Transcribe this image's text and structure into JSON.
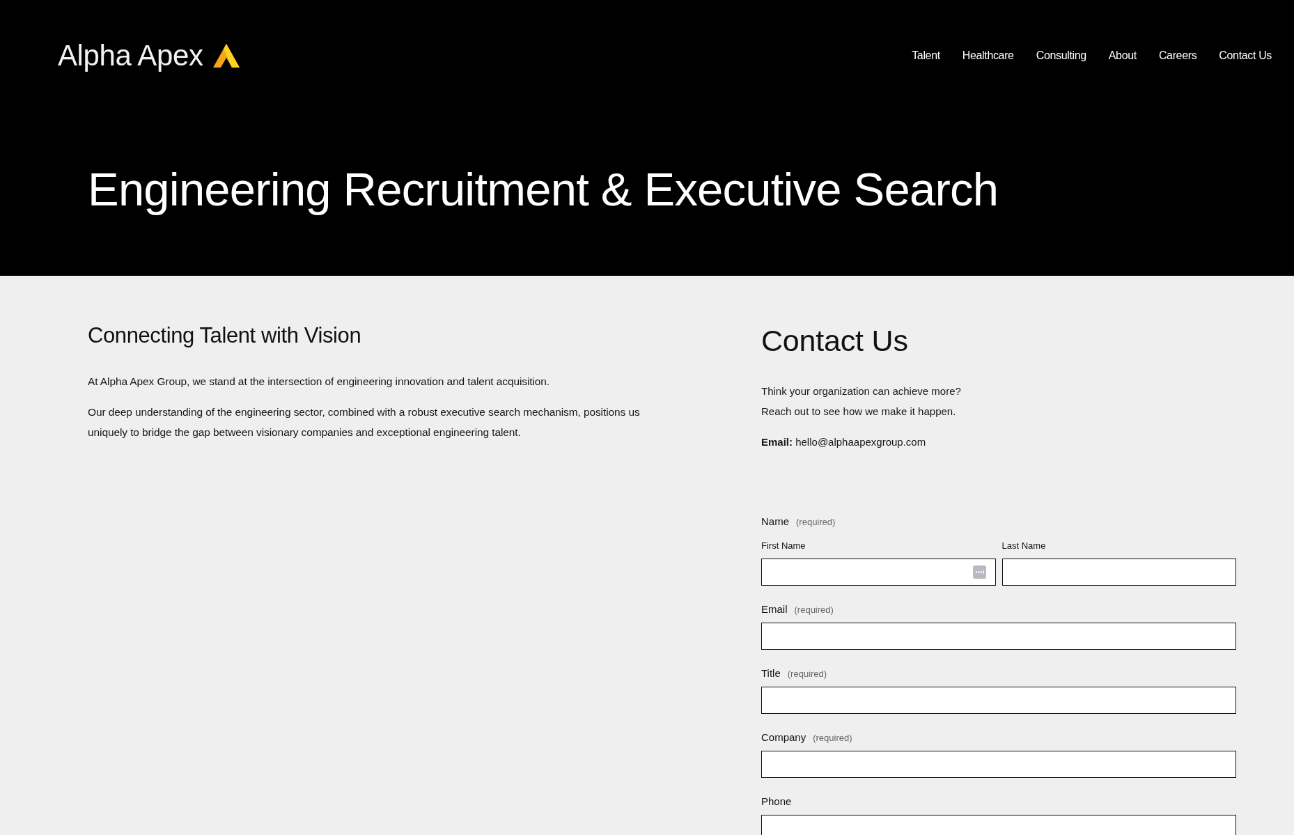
{
  "header": {
    "logo": {
      "text": "Alpha Apex"
    },
    "nav": [
      {
        "label": "Talent"
      },
      {
        "label": "Healthcare"
      },
      {
        "label": "Consulting"
      },
      {
        "label": "About"
      },
      {
        "label": "Careers"
      },
      {
        "label": "Contact Us"
      }
    ]
  },
  "hero": {
    "title": "Engineering Recruitment & Executive Search"
  },
  "intro": {
    "heading": "Connecting Talent with Vision",
    "paragraphs": [
      "At Alpha Apex Group, we stand at the intersection of engineering innovation and talent acquisition.",
      "Our deep understanding of the engineering sector, combined with a robust executive search mechanism, positions us uniquely to bridge the gap between visionary companies and exceptional engineering talent."
    ]
  },
  "contact": {
    "heading": "Contact Us",
    "lines": [
      "Think your organization can achieve more?",
      "Reach out to see how we make it happen."
    ],
    "email_line": "**Email:** hello@alphaapexgroup.com"
  },
  "form": {
    "fields": [
      {
        "kind": "split",
        "label": "Name",
        "note": "(required)",
        "subfields": [
          {
            "label": "First Name",
            "autofill_icon": true
          },
          {
            "label": "Last Name"
          }
        ]
      },
      {
        "kind": "single",
        "label": "Email",
        "note": "(required)"
      },
      {
        "kind": "single",
        "label": "Title",
        "note": "(required)"
      },
      {
        "kind": "single",
        "label": "Company",
        "note": "(required)"
      },
      {
        "kind": "single",
        "label": "Phone"
      }
    ]
  }
}
